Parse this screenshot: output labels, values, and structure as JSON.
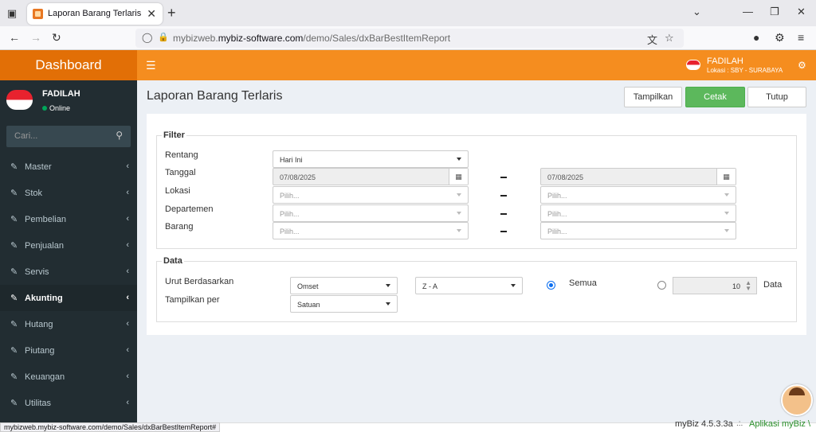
{
  "browser": {
    "tab_title": "Laporan Barang Terlaris",
    "url_prefix": "mybizweb.",
    "url_domain": "mybiz-software.com",
    "url_path": "/demo/Sales/dxBarBestItemReport",
    "status_url": "mybizweb.mybiz-software.com/demo/Sales/dxBarBestItemReport#"
  },
  "app": {
    "brand": "Dashboard",
    "user_name": "FADILAH",
    "user_location": "Lokasi : SBY - SURABAYA",
    "user_status": "Online",
    "search_placeholder": "Cari...",
    "version": "myBiz 4.5.3.3a",
    "footer_dots": ".:.",
    "footer_app": "Aplikasi myBiz \\"
  },
  "sidebar": {
    "items": [
      {
        "label": "Master"
      },
      {
        "label": "Stok"
      },
      {
        "label": "Pembelian"
      },
      {
        "label": "Penjualan"
      },
      {
        "label": "Servis"
      },
      {
        "label": "Akunting",
        "active": true
      },
      {
        "label": "Hutang"
      },
      {
        "label": "Piutang"
      },
      {
        "label": "Keuangan"
      },
      {
        "label": "Utilitas"
      }
    ]
  },
  "page": {
    "title": "Laporan Barang Terlaris",
    "btn_show": "Tampilkan",
    "btn_print": "Cetak",
    "btn_close": "Tutup"
  },
  "filter": {
    "legend": "Filter",
    "rentang_label": "Rentang",
    "rentang_value": "Hari Ini",
    "tanggal_label": "Tanggal",
    "date_from": "07/08/2025",
    "date_to": "07/08/2025",
    "lokasi_label": "Lokasi",
    "departemen_label": "Departemen",
    "barang_label": "Barang",
    "placeholder": "Pilih..."
  },
  "data": {
    "legend": "Data",
    "urut_label": "Urut Berdasarkan",
    "urut_value": "Omset",
    "order_value": "Z - A",
    "semua_label": "Semua",
    "limit_value": "10",
    "data_label": "Data",
    "tampilkan_label": "Tampilkan per",
    "tampilkan_value": "Satuan"
  }
}
